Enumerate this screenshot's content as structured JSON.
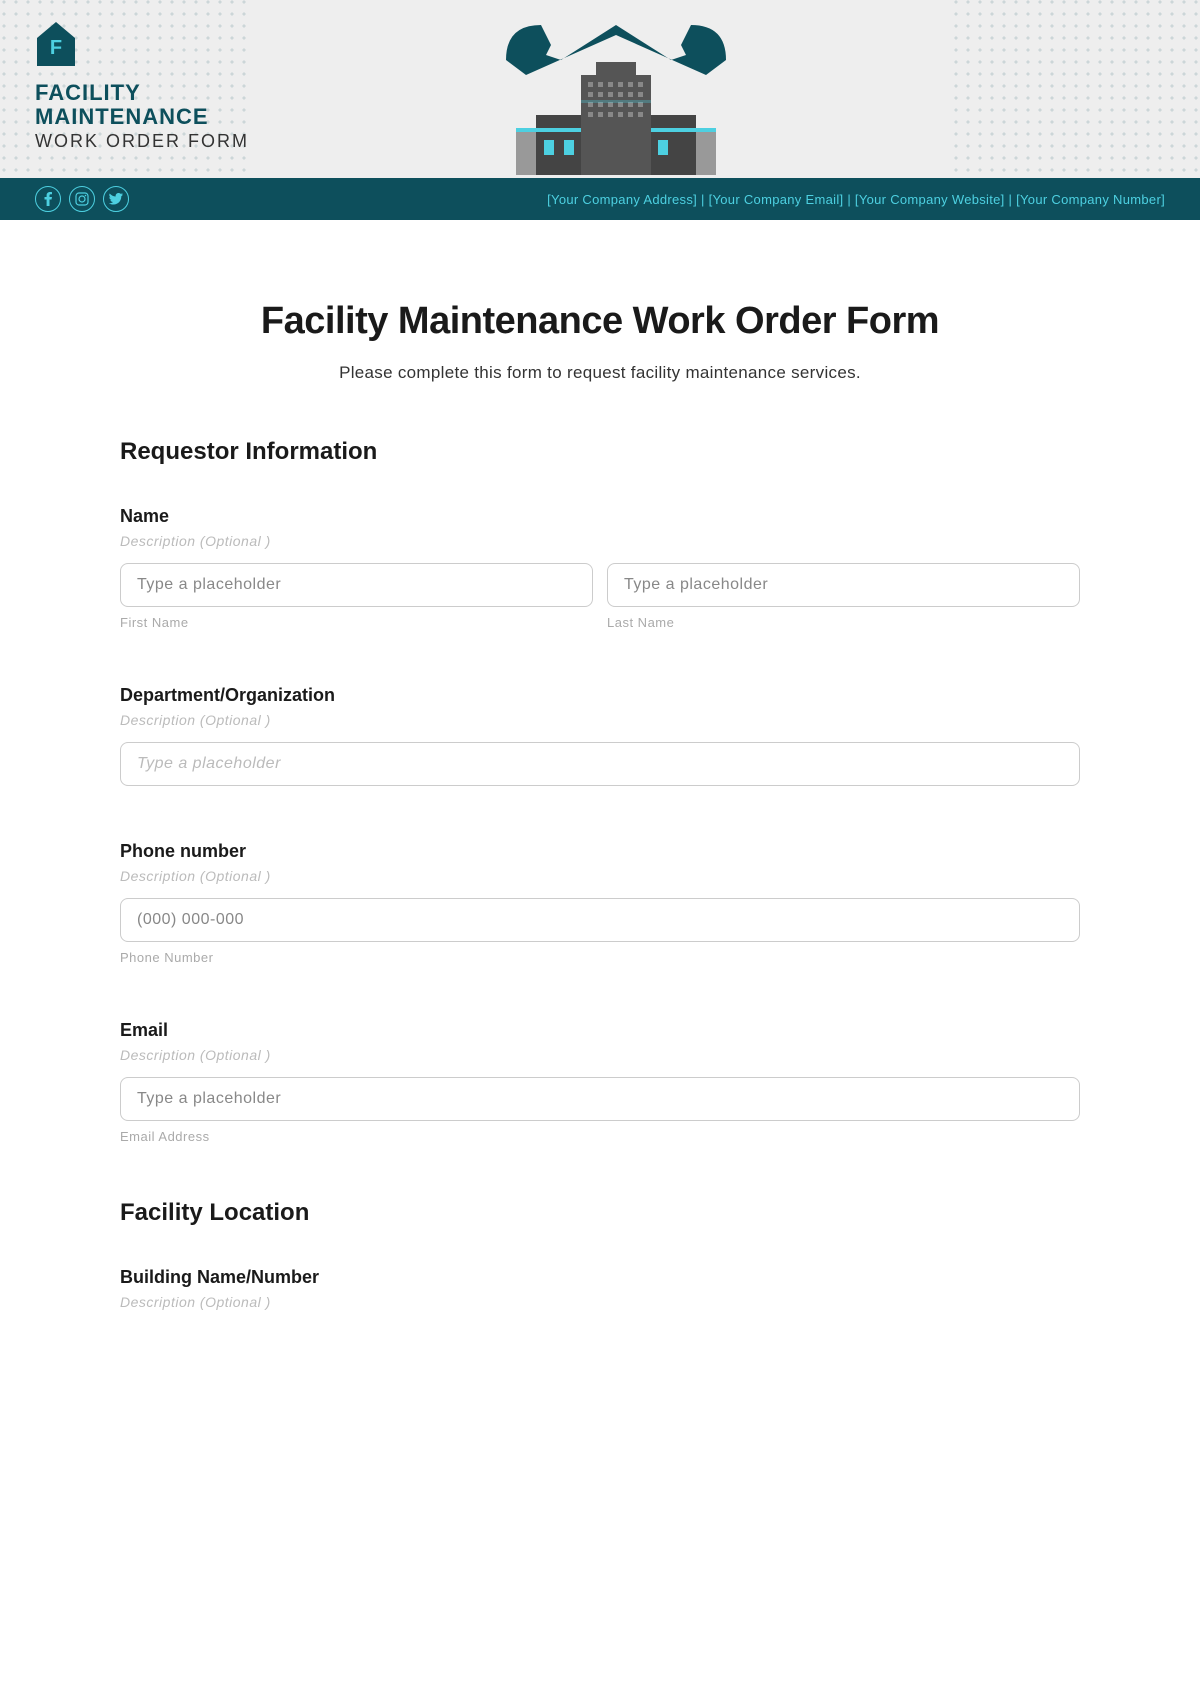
{
  "header": {
    "logo_line1": "FACILITY",
    "logo_line2": "MAINTENANCE",
    "logo_subtitle": "WORK ORDER FORM",
    "company_info": "[Your Company Address] | [Your Company Email] | [Your Company Website] | [Your Company Number]"
  },
  "form": {
    "title": "Facility Maintenance Work Order Form",
    "subtitle": "Please complete this form to request facility maintenance services."
  },
  "sections": {
    "requestor": {
      "title": "Requestor Information",
      "fields": {
        "name": {
          "label": "Name",
          "description": "Description (Optional )",
          "first_placeholder": "Type a placeholder",
          "first_sublabel": "First Name",
          "last_placeholder": "Type a placeholder",
          "last_sublabel": "Last Name"
        },
        "department": {
          "label": "Department/Organization",
          "description": "Description (Optional )",
          "placeholder": "Type a placeholder"
        },
        "phone": {
          "label": "Phone number",
          "description": "Description (Optional )",
          "placeholder": "(000) 000-000",
          "sublabel": "Phone Number"
        },
        "email": {
          "label": "Email",
          "description": "Description (Optional )",
          "placeholder": "Type a placeholder",
          "sublabel": "Email Address"
        }
      }
    },
    "facility": {
      "title": "Facility Location",
      "fields": {
        "building": {
          "label": "Building Name/Number",
          "description": "Description (Optional )"
        }
      }
    }
  }
}
